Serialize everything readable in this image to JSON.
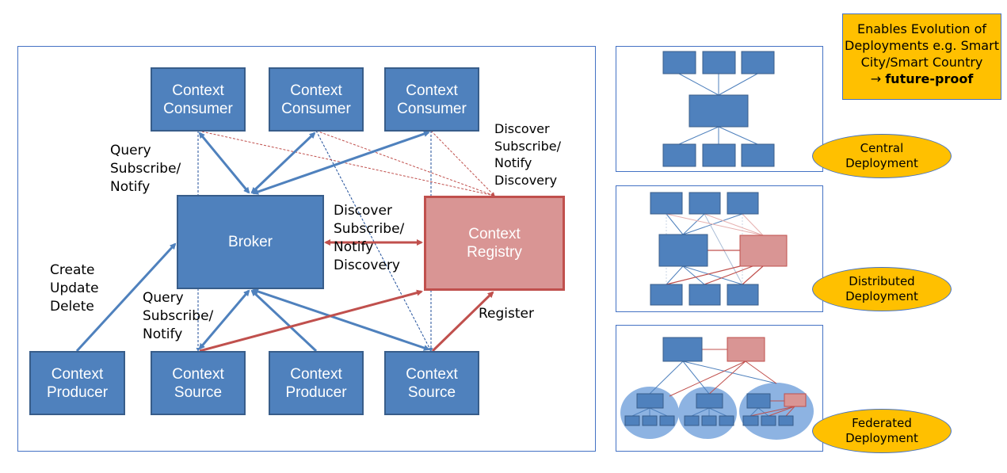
{
  "main": {
    "consumers": [
      "Context\nConsumer",
      "Context\nConsumer",
      "Context\nConsumer"
    ],
    "broker": "Broker",
    "registry": "Context\nRegistry",
    "bottom": [
      "Context\nProducer",
      "Context\nSource",
      "Context\nProducer",
      "Context\nSource"
    ],
    "labels": {
      "query_top": "Query\nSubscribe/\nNotify",
      "discover_top": "Discover\nSubscribe/\nNotify\nDiscovery",
      "discover_mid": "Discover\nSubscribe/\nNotify\nDiscovery",
      "create": "Create\nUpdate\nDelete",
      "query_bottom": "Query\nSubscribe/\nNotify",
      "register": "Register"
    }
  },
  "note": {
    "line1": "Enables Evolution of Deployments e.g. Smart City/Smart Country",
    "arrow": "→",
    "bold": "future-proof"
  },
  "deployments": [
    "Central\nDeployment",
    "Distributed\nDeployment",
    "Federated\nDeployment"
  ],
  "colors": {
    "blue": "#4f81bd",
    "red": "#c0504d",
    "registry_fill": "#d99594",
    "yellow": "#ffc000"
  }
}
